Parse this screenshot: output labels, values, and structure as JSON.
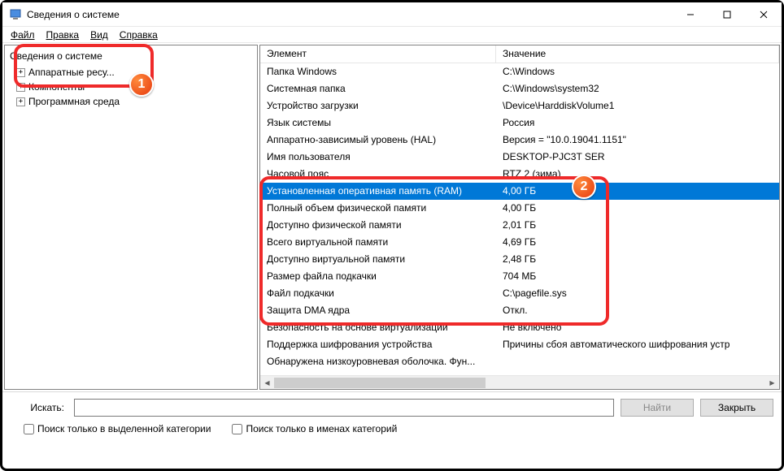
{
  "window": {
    "title": "Сведения о системе"
  },
  "menu": {
    "file": "Файл",
    "edit": "Правка",
    "view": "Вид",
    "help": "Справка"
  },
  "tree": {
    "root": "Сведения о системе",
    "items": [
      {
        "label": "Аппаратные ресу..."
      },
      {
        "label": "Компоненты"
      },
      {
        "label": "Программная среда"
      }
    ]
  },
  "columns": {
    "element": "Элемент",
    "value": "Значение"
  },
  "rows": [
    {
      "name": "Папка Windows",
      "value": "C:\\Windows"
    },
    {
      "name": "Системная папка",
      "value": "C:\\Windows\\system32"
    },
    {
      "name": "Устройство загрузки",
      "value": "\\Device\\HarddiskVolume1"
    },
    {
      "name": "Язык системы",
      "value": "Россия"
    },
    {
      "name": "Аппаратно-зависимый уровень (HAL)",
      "value": "Версия = \"10.0.19041.1151\""
    },
    {
      "name": "Имя пользователя",
      "value": "DESKTOP-PJC3T       SER"
    },
    {
      "name": "Часовой пояс",
      "value": "RTZ 2 (зима)"
    },
    {
      "name": "Установленная оперативная память (RAM)",
      "value": "4,00 ГБ",
      "selected": true
    },
    {
      "name": "Полный объем физической памяти",
      "value": "4,00 ГБ"
    },
    {
      "name": "Доступно физической памяти",
      "value": "2,01 ГБ"
    },
    {
      "name": "Всего виртуальной памяти",
      "value": "4,69 ГБ"
    },
    {
      "name": "Доступно виртуальной памяти",
      "value": "2,48 ГБ"
    },
    {
      "name": "Размер файла подкачки",
      "value": "704 МБ"
    },
    {
      "name": "Файл подкачки",
      "value": "C:\\pagefile.sys"
    },
    {
      "name": "Защита DMA ядра",
      "value": "Откл."
    },
    {
      "name": "Безопасность на основе виртуализации",
      "value": "Не включено"
    },
    {
      "name": "Поддержка шифрования устройства",
      "value": "Причины сбоя автоматического шифрования устр"
    },
    {
      "name": "Обнаружена низкоуровневая оболочка. Фун...",
      "value": ""
    }
  ],
  "search": {
    "label": "Искать:",
    "find": "Найти",
    "close": "Закрыть",
    "cb1": "Поиск только в выделенной категории",
    "cb2": "Поиск только в именах категорий"
  },
  "badges": {
    "one": "1",
    "two": "2"
  }
}
